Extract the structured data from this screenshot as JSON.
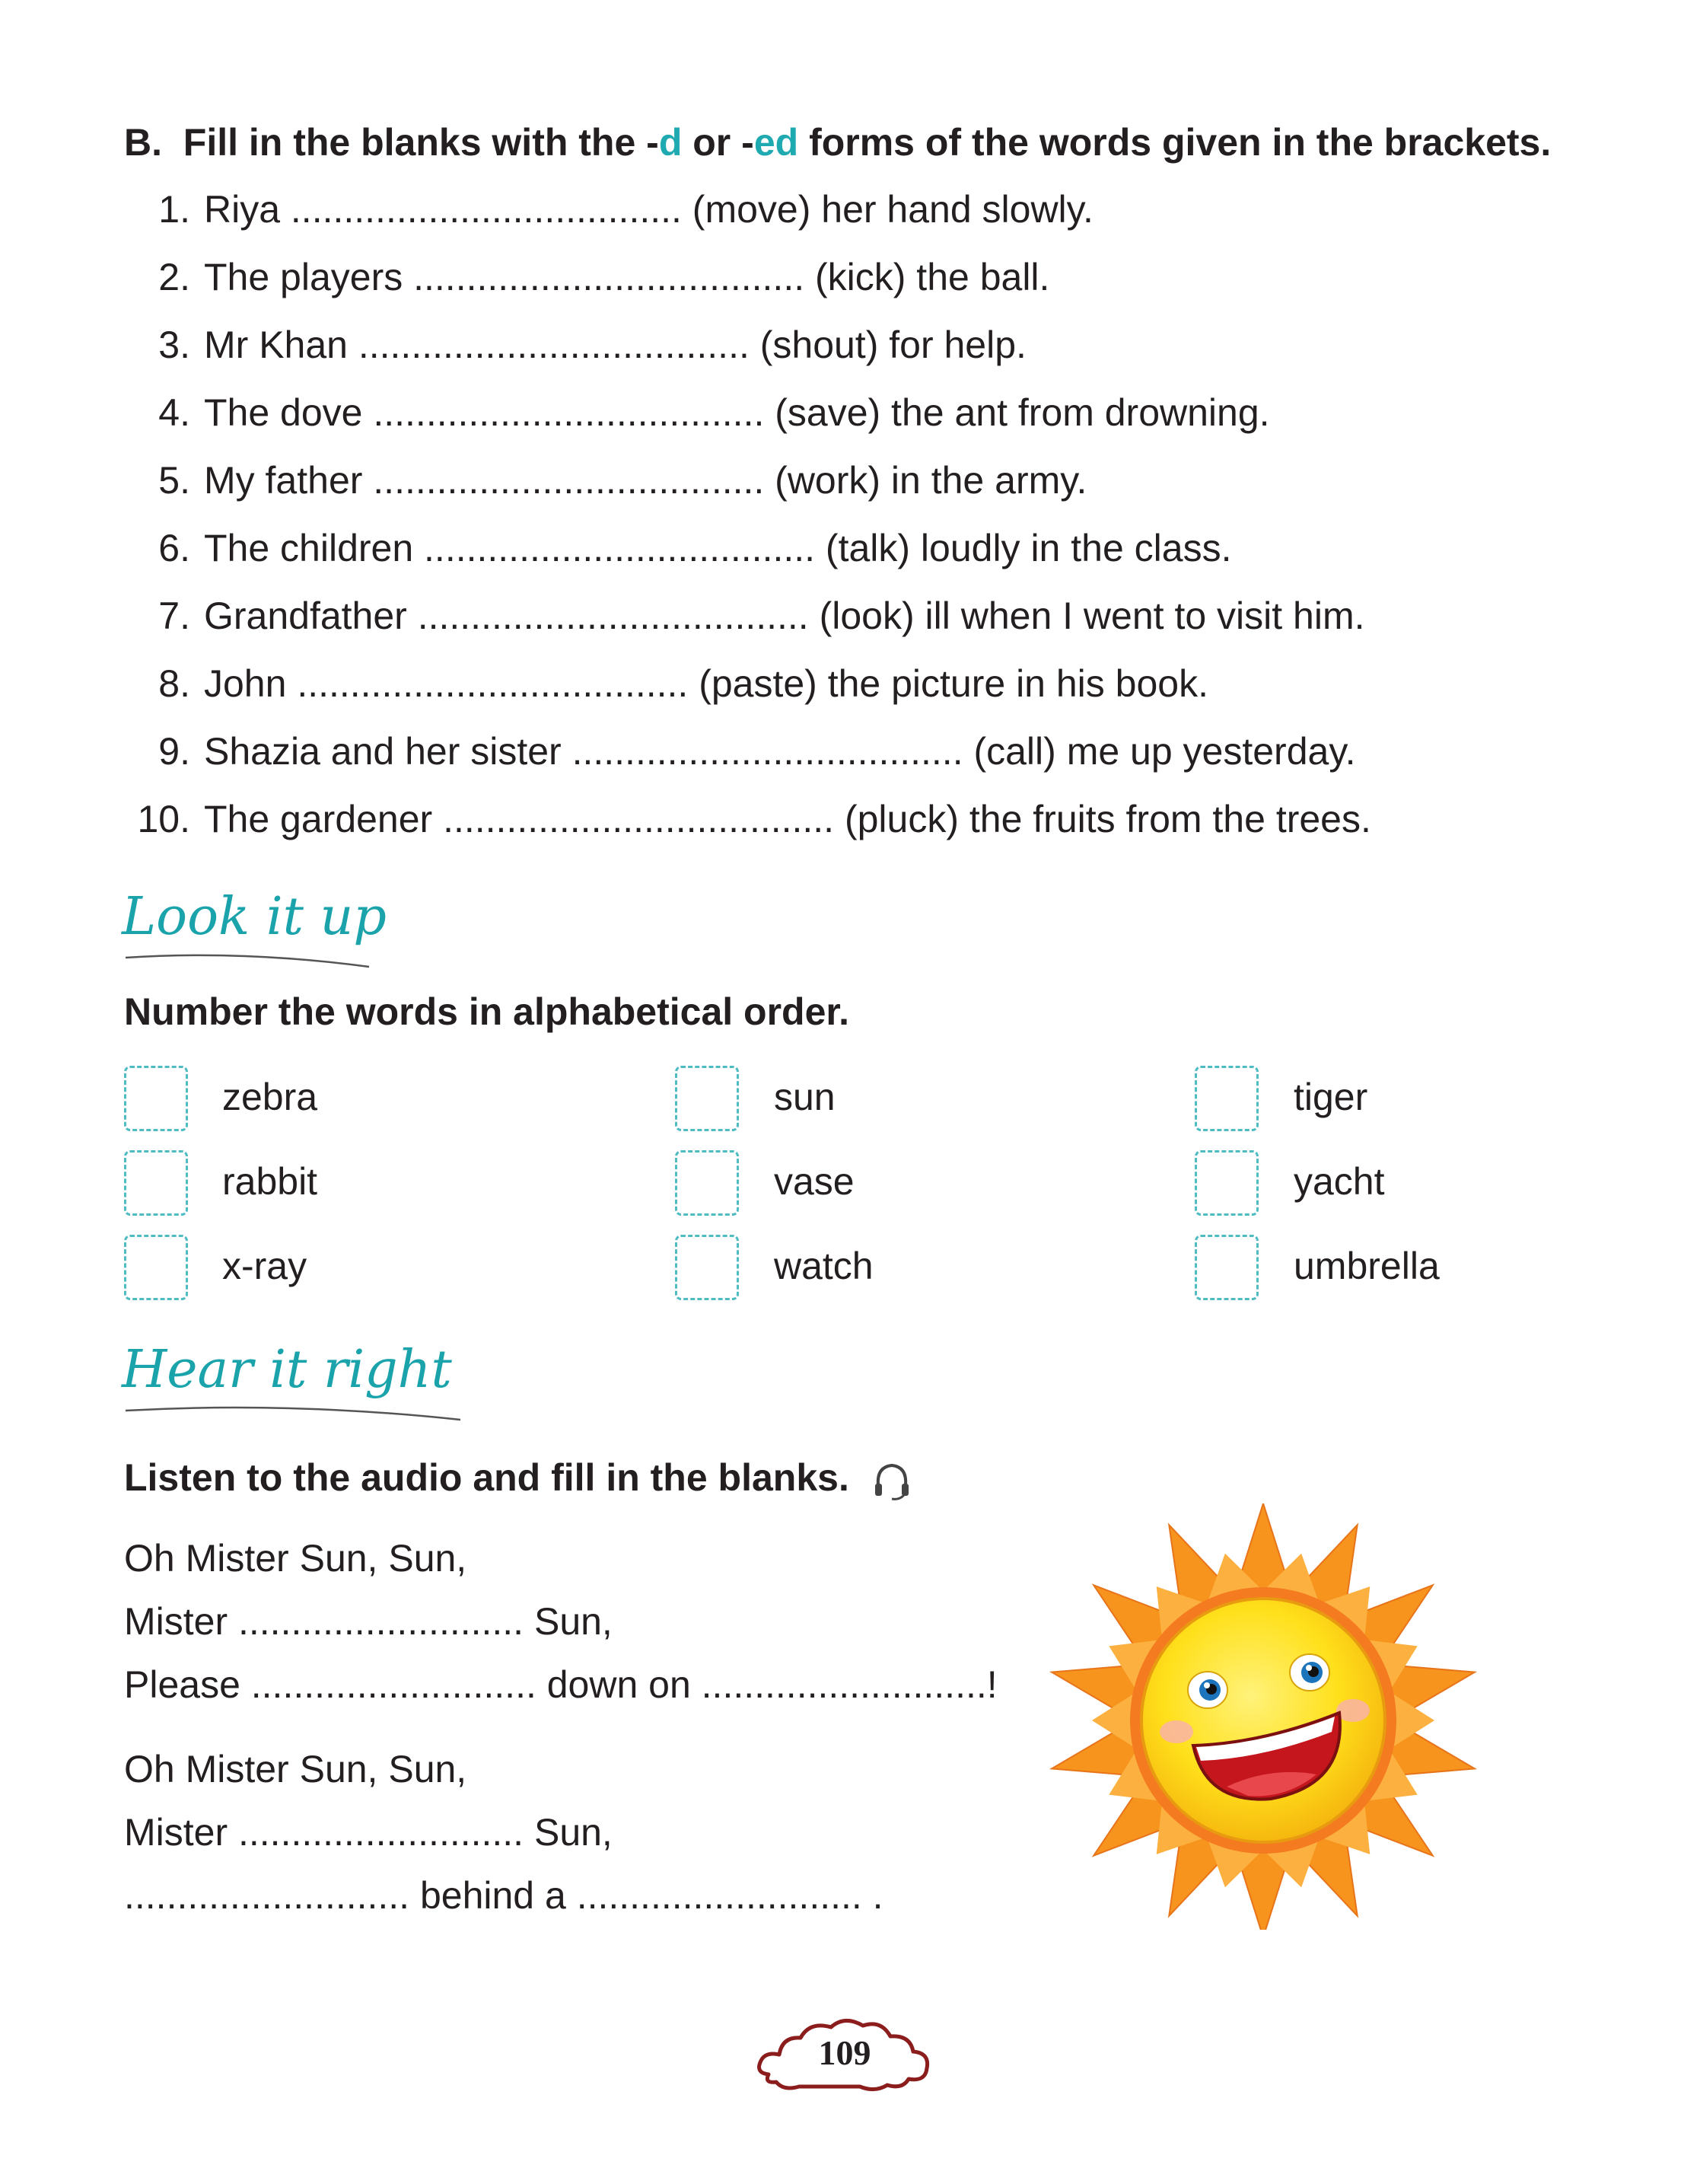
{
  "exercise_b": {
    "letter": "B.",
    "instr_1": "Fill in the blanks with the -",
    "instr_d": "d",
    "instr_2": " or -",
    "instr_ed": "ed",
    "instr_3": " forms of the words given in the brackets.",
    "items": [
      {
        "n": "1.",
        "text": "Riya ..................................... (move) her hand slowly."
      },
      {
        "n": "2.",
        "text": "The players ..................................... (kick) the ball."
      },
      {
        "n": "3.",
        "text": "Mr Khan ..................................... (shout) for help."
      },
      {
        "n": "4.",
        "text": "The dove ..................................... (save) the ant from drowning."
      },
      {
        "n": "5.",
        "text": "My father ..................................... (work) in the army."
      },
      {
        "n": "6.",
        "text": "The children ..................................... (talk) loudly in the class."
      },
      {
        "n": "7.",
        "text": "Grandfather ..................................... (look) ill when I went to visit him."
      },
      {
        "n": "8.",
        "text": "John ..................................... (paste) the picture in his book."
      },
      {
        "n": "9.",
        "text": "Shazia and her sister ..................................... (call) me up yesterday."
      },
      {
        "n": "10.",
        "text": "The gardener ..................................... (pluck) the fruits from the trees."
      }
    ]
  },
  "look_it_up": {
    "heading": "Look it up",
    "instruction": "Number the words in alphabetical order.",
    "words": [
      "zebra",
      "rabbit",
      "x-ray",
      "sun",
      "vase",
      "watch",
      "tiger",
      "yacht",
      "umbrella"
    ]
  },
  "hear_it_right": {
    "heading": "Hear it right",
    "instruction": "Listen to the audio and fill in the blanks.",
    "audio_icon": "headphones-icon",
    "lines": [
      "Oh Mister Sun, Sun,",
      "Mister ........................... Sun,",
      "Please ........................... down on ...........................!",
      "Oh Mister Sun, Sun,",
      "Mister ........................... Sun,",
      "........................... behind a ........................... ."
    ]
  },
  "page_number": "109",
  "colors": {
    "accent": "#1fa9b0",
    "text": "#231f20",
    "sun_orange": "#f7941d",
    "sun_yellow": "#ffe01b",
    "cloud": "#8b1d1d"
  }
}
